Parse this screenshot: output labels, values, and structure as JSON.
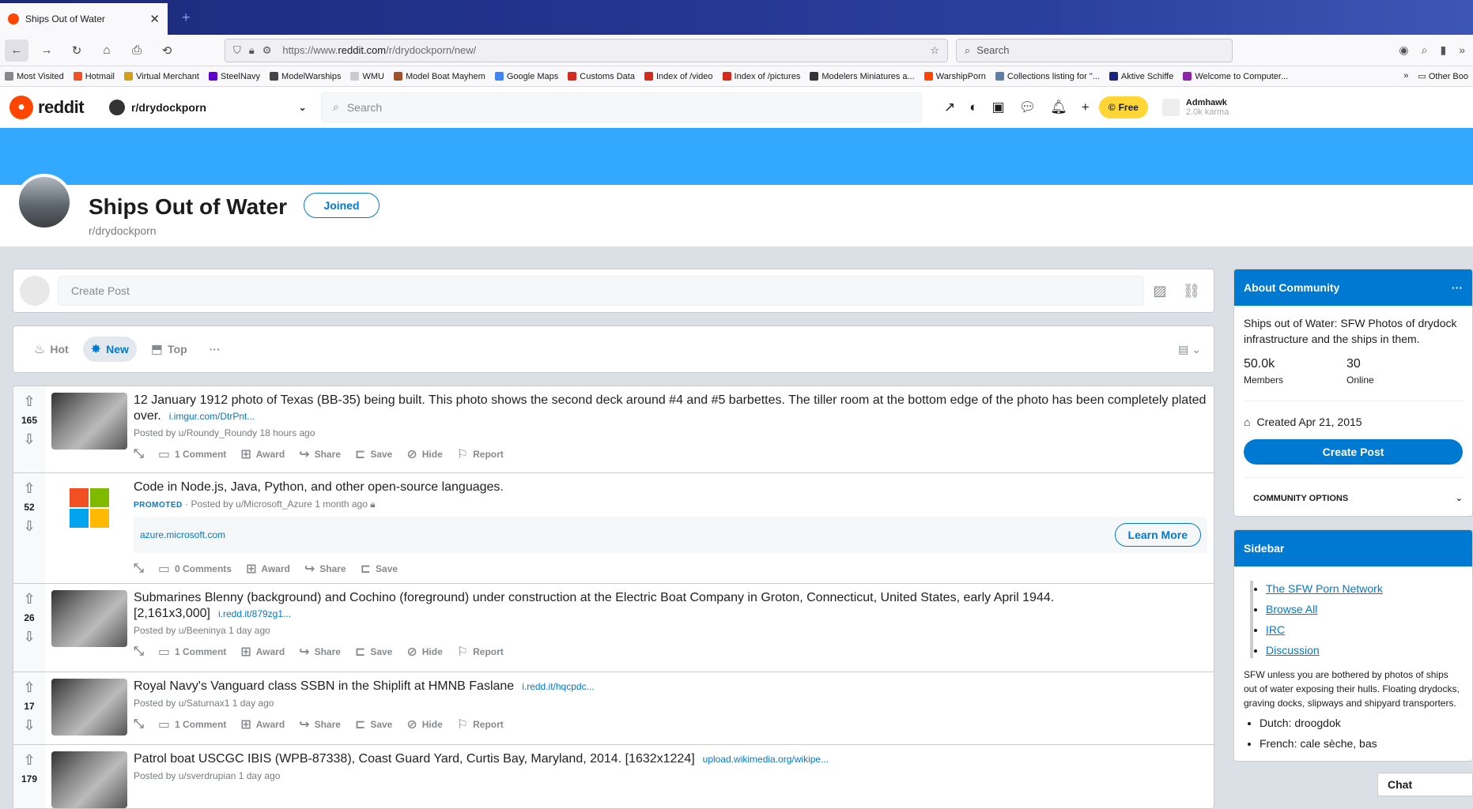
{
  "browser": {
    "tab_title": "Ships Out of Water",
    "url_prefix": "https://www.",
    "url_domain": "reddit.com",
    "url_path": "/r/drydockporn/new/",
    "search_placeholder": "Search"
  },
  "bookmarks": [
    {
      "label": "Most Visited",
      "color": "#888888"
    },
    {
      "label": "Hotmail",
      "color": "#f25022"
    },
    {
      "label": "Virtual Merchant",
      "color": "#d4a017"
    },
    {
      "label": "SteelNavy",
      "color": "#6001d2"
    },
    {
      "label": "ModelWarships",
      "color": "#444444"
    },
    {
      "label": "WMU",
      "color": "#cccccc"
    },
    {
      "label": "Model Boat Mayhem",
      "color": "#a0522d"
    },
    {
      "label": "Google Maps",
      "color": "#4285f4"
    },
    {
      "label": "Customs Data",
      "color": "#d52b1e"
    },
    {
      "label": "Index of /video",
      "color": "#d52b1e"
    },
    {
      "label": "Index of /pictures",
      "color": "#d52b1e"
    },
    {
      "label": "Modelers Miniatures a...",
      "color": "#333333"
    },
    {
      "label": "WarshipPorn",
      "color": "#ff4500"
    },
    {
      "label": "Collections listing for \"...",
      "color": "#5b7fa6"
    },
    {
      "label": "Aktive Schiffe",
      "color": "#1a237e"
    },
    {
      "label": "Welcome to Computer...",
      "color": "#8e24aa"
    }
  ],
  "bookmarks_other": "Other Boo",
  "reddit": {
    "logo_text": "reddit",
    "subreddit_selector": "r/drydockporn",
    "search_placeholder": "Search",
    "free_label": "Free",
    "username": "Admhawk",
    "karma": "2.0k karma"
  },
  "subreddit": {
    "title": "Ships Out of Water",
    "name": "r/drydockporn",
    "joined_label": "Joined"
  },
  "create_post_placeholder": "Create Post",
  "sort": {
    "hot": "Hot",
    "new": "New",
    "top": "Top",
    "more": "···"
  },
  "posts": [
    {
      "score": "165",
      "title": "12 January 1912 photo of Texas (BB-35) being built. This photo shows the second deck around #4 and #5 barbettes. The tiller room at the bottom edge of the photo has been completely plated over.",
      "link": "i.imgur.com/DtrPnt...",
      "meta": "Posted by u/Roundy_Roundy 18 hours ago",
      "comments": "1 Comment"
    },
    {
      "score": "52",
      "title": "Code in Node.js, Java, Python, and other open-source languages.",
      "promoted": "PROMOTED",
      "meta": "· Posted by u/Microsoft_Azure 1 month ago",
      "promo_url": "azure.microsoft.com",
      "learn_more": "Learn More",
      "comments": "0 Comments"
    },
    {
      "score": "26",
      "title": "Submarines Blenny (background) and Cochino (foreground) under construction at the Electric Boat Company in Groton, Connecticut, United States, early April 1944.[2,161x3,000]",
      "link": "i.redd.it/879zg1...",
      "meta": "Posted by u/Beeninya 1 day ago",
      "comments": "1 Comment"
    },
    {
      "score": "17",
      "title": "Royal Navy's Vanguard class SSBN in the Shiplift at HMNB Faslane",
      "link": "i.redd.it/hqcpdc...",
      "meta": "Posted by u/Saturnax1 1 day ago",
      "comments": "1 Comment"
    },
    {
      "score": "179",
      "title": "Patrol boat USCGC IBIS (WPB-87338), Coast Guard Yard, Curtis Bay, Maryland, 2014. [1632x1224]",
      "link": "upload.wikimedia.org/wikipe...",
      "meta": "Posted by u/sverdrupian 1 day ago",
      "comments": ""
    }
  ],
  "actions": {
    "award": "Award",
    "share": "Share",
    "save": "Save",
    "hide": "Hide",
    "report": "Report"
  },
  "about": {
    "header": "About Community",
    "description": "Ships out of Water: SFW Photos of drydock infrastructure and the ships in them.",
    "members": "50.0k",
    "members_label": "Members",
    "online": "30",
    "online_label": "Online",
    "created": "Created Apr 21, 2015",
    "create_post": "Create Post",
    "community_options": "COMMUNITY OPTIONS"
  },
  "sidebar": {
    "header": "Sidebar",
    "links": [
      "The SFW Porn Network",
      "Browse All",
      "IRC",
      "Discussion"
    ],
    "text": "SFW unless you are bothered by photos of ships out of water exposing their hulls. Floating drydocks, graving docks, slipways and shipyard transporters.",
    "bullets": [
      "Dutch: droogdok",
      "French: cale sèche, bas"
    ]
  },
  "chat_label": "Chat"
}
